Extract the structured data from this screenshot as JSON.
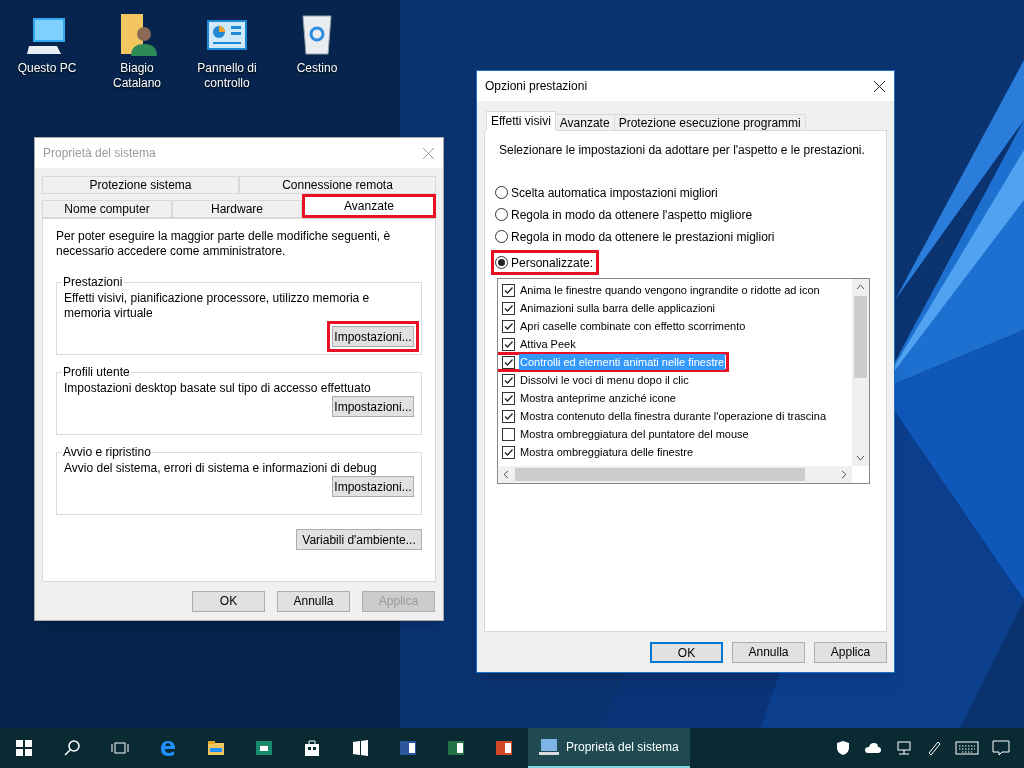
{
  "desktop_icons": [
    {
      "label": "Questo PC",
      "kind": "pc"
    },
    {
      "label": "Biagio Catalano",
      "kind": "user"
    },
    {
      "label": "Pannello di controllo",
      "kind": "panel"
    },
    {
      "label": "Cestino",
      "kind": "bin"
    }
  ],
  "system_properties": {
    "title": "Proprietà del sistema",
    "tab_rows": [
      [
        {
          "label": "Protezione sistema",
          "selected": false,
          "highlighted": false
        },
        {
          "label": "Connessione remota",
          "selected": false,
          "highlighted": false
        }
      ],
      [
        {
          "label": "Nome computer",
          "selected": false,
          "highlighted": false
        },
        {
          "label": "Hardware",
          "selected": false,
          "highlighted": false
        },
        {
          "label": "Avanzate",
          "selected": true,
          "highlighted": true
        }
      ]
    ],
    "intro": "Per poter eseguire la maggior parte delle modifiche seguenti, è necessario accedere come amministratore.",
    "groups": [
      {
        "title": "Prestazioni",
        "text": "Effetti visivi, pianificazione processore, utilizzo memoria e memoria virtuale",
        "button": "Impostazioni...",
        "highlighted": true
      },
      {
        "title": "Profili utente",
        "text": "Impostazioni desktop basate sul tipo di accesso effettuato",
        "button": "Impostazioni...",
        "highlighted": false
      },
      {
        "title": "Avvio e ripristino",
        "text": "Avvio del sistema, errori di sistema e informazioni di debug",
        "button": "Impostazioni...",
        "highlighted": false
      }
    ],
    "env_button": "Variabili d'ambiente...",
    "buttons": [
      {
        "label": "OK",
        "disabled": false
      },
      {
        "label": "Annulla",
        "disabled": false
      },
      {
        "label": "Applica",
        "disabled": true
      }
    ]
  },
  "performance_options": {
    "title": "Opzioni prestazioni",
    "tabs": [
      {
        "label": "Effetti visivi",
        "selected": true
      },
      {
        "label": "Avanzate",
        "selected": false
      },
      {
        "label": "Protezione esecuzione programmi",
        "selected": false
      }
    ],
    "intro": "Selezionare le impostazioni da adottare per l'aspetto e le prestazioni.",
    "radios": [
      {
        "label": "Scelta automatica impostazioni migliori",
        "selected": false,
        "highlighted": false
      },
      {
        "label": "Regola in modo da ottenere l'aspetto migliore",
        "selected": false,
        "highlighted": false
      },
      {
        "label": "Regola in modo da ottenere le prestazioni migliori",
        "selected": false,
        "highlighted": false
      },
      {
        "label": "Personalizzate:",
        "selected": true,
        "highlighted": true
      }
    ],
    "effects": [
      {
        "label": "Anima le finestre quando vengono ingrandite o ridotte ad icon",
        "checked": true,
        "selected": false,
        "highlighted": false
      },
      {
        "label": "Animazioni sulla barra delle applicazioni",
        "checked": true,
        "selected": false,
        "highlighted": false
      },
      {
        "label": "Apri caselle combinate con effetto scorrimento",
        "checked": true,
        "selected": false,
        "highlighted": false
      },
      {
        "label": "Attiva Peek",
        "checked": true,
        "selected": false,
        "highlighted": false
      },
      {
        "label": "Controlli ed elementi animati nelle finestre",
        "checked": true,
        "selected": true,
        "highlighted": true
      },
      {
        "label": "Dissolvi le voci di menu dopo il clic",
        "checked": true,
        "selected": false,
        "highlighted": false
      },
      {
        "label": "Mostra anteprime anziché icone",
        "checked": true,
        "selected": false,
        "highlighted": false
      },
      {
        "label": "Mostra contenuto della finestra durante l'operazione di trascina",
        "checked": true,
        "selected": false,
        "highlighted": false
      },
      {
        "label": "Mostra ombreggiatura del puntatore del mouse",
        "checked": false,
        "selected": false,
        "highlighted": false
      },
      {
        "label": "Mostra ombreggiatura delle finestre",
        "checked": true,
        "selected": false,
        "highlighted": false
      }
    ],
    "buttons": [
      {
        "label": "OK",
        "default": true
      },
      {
        "label": "Annulla",
        "default": false
      },
      {
        "label": "Applica",
        "default": false
      }
    ]
  },
  "taskbar": {
    "apps": [
      {
        "label": "Proprietà del sistema",
        "selected": true
      }
    ]
  }
}
